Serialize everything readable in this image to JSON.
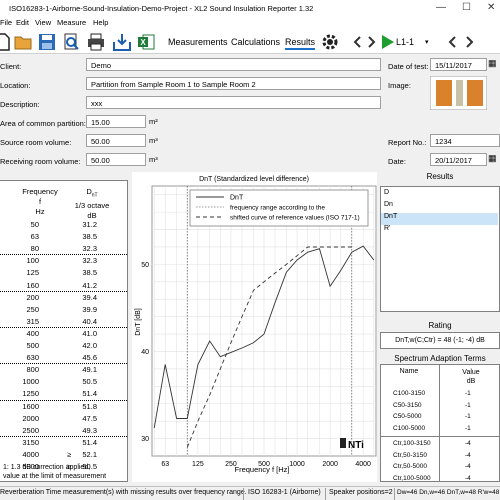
{
  "window": {
    "title": "ISO16283-1-Airborne-Sound-Insulation-Demo-Project - XL2 Sound Insulation Reporter 1.32"
  },
  "menu": {
    "file": "File",
    "edit": "Edit",
    "view": "View",
    "measure": "Measure",
    "help": "Help"
  },
  "toolbar": {
    "measurements": "Measurements",
    "calculations": "Calculations",
    "results": "Results",
    "position": "L1-1"
  },
  "form": {
    "client_label": "Client:",
    "client_value": "Demo",
    "location_label": "Location:",
    "location_value": "Partition from Sample Room 1 to Sample Room 2",
    "description_label": "Description:",
    "description_value": "xxx",
    "area_label": "Area of common partition:",
    "area_value": "15.00",
    "area_unit": "m²",
    "source_label": "Source room volume:",
    "source_value": "50.00",
    "source_unit": "m³",
    "receiving_label": "Receiving room volume:",
    "receiving_value": "50.00",
    "receiving_unit": "m³",
    "date_of_test_label": "Date of test:",
    "date_of_test_value": "15/11/2017",
    "image_label": "Image:",
    "report_label": "Report No.:",
    "report_value": "1234",
    "date_label": "Date:",
    "date_value": "20/11/2017"
  },
  "table": {
    "col1_header": [
      "Frequency",
      "f",
      "Hz"
    ],
    "col2_header": [
      "DnT",
      "1/3 octave",
      "dB"
    ],
    "rows": [
      {
        "f": "50",
        "q": "",
        "v": "31.2"
      },
      {
        "f": "63",
        "q": "",
        "v": "38.5"
      },
      {
        "f": "80",
        "q": "",
        "v": "32.3"
      },
      {
        "f": "100",
        "q": "",
        "v": "32.3"
      },
      {
        "f": "125",
        "q": "",
        "v": "38.5"
      },
      {
        "f": "160",
        "q": "",
        "v": "41.2"
      },
      {
        "f": "200",
        "q": "",
        "v": "39.4"
      },
      {
        "f": "250",
        "q": "",
        "v": "39.9"
      },
      {
        "f": "315",
        "q": "",
        "v": "40.4"
      },
      {
        "f": "400",
        "q": "",
        "v": "41.0"
      },
      {
        "f": "500",
        "q": "",
        "v": "42.0"
      },
      {
        "f": "630",
        "q": "",
        "v": "45.6"
      },
      {
        "f": "800",
        "q": "",
        "v": "49.1"
      },
      {
        "f": "1000",
        "q": "",
        "v": "50.5"
      },
      {
        "f": "1250",
        "q": "",
        "v": "51.4"
      },
      {
        "f": "1600",
        "q": "",
        "v": "51.8"
      },
      {
        "f": "2000",
        "q": "",
        "v": "47.5"
      },
      {
        "f": "2500",
        "q": "",
        "v": "49.3"
      },
      {
        "f": "3150",
        "q": "",
        "v": "51.4"
      },
      {
        "f": "4000",
        "q": "≥",
        "v": "52.1"
      },
      {
        "f": "5000",
        "q": "≥",
        "v": "50.5"
      }
    ],
    "note1": "1: 1.3 dB correction applied,",
    "note2": "value at the limit of measurement"
  },
  "chart_data": {
    "type": "line",
    "title": "DnT (Standardized level difference)",
    "xlabel": "Frequency f [Hz]",
    "ylabel": "DnT [dB]",
    "x": [
      50,
      63,
      80,
      100,
      125,
      160,
      200,
      250,
      315,
      400,
      500,
      630,
      800,
      1000,
      1250,
      1600,
      2000,
      2500,
      3150,
      4000,
      5000
    ],
    "xticks": [
      "63",
      "125",
      "250",
      "500",
      "1000",
      "2000",
      "4000"
    ],
    "yticks": [
      30,
      40,
      50
    ],
    "ylim": [
      28,
      59
    ],
    "series": [
      {
        "name": "DnT",
        "style": "solid",
        "values": [
          31.2,
          38.5,
          32.3,
          32.3,
          38.5,
          41.2,
          39.4,
          39.9,
          40.4,
          41.0,
          42.0,
          45.6,
          49.1,
          50.5,
          51.4,
          51.8,
          47.5,
          49.3,
          51.4,
          52.1,
          50.5
        ]
      },
      {
        "name": "",
        "style": "dashed",
        "x": [
          100,
          125,
          160,
          200,
          250,
          315,
          400,
          500,
          630,
          800,
          1000,
          1250,
          1600,
          2000,
          2500,
          3150
        ],
        "values": [
          29,
          32,
          35,
          38,
          41,
          44,
          47,
          48,
          49,
          50,
          51,
          52,
          52,
          52,
          52,
          52
        ]
      }
    ],
    "legend": [
      "DnT",
      "frequency range according to the",
      "shifted curve of reference values (ISO 717-1)"
    ],
    "legend_position": "top-right",
    "freq_range_lines": [
      100,
      3150
    ],
    "grid": true,
    "brand": "NTi"
  },
  "results": {
    "title": "Results",
    "items": [
      "D",
      "Dn",
      "DnT",
      "R'"
    ],
    "selected": 2,
    "rating_title": "Rating",
    "rating_value": "DnT,w(C;Ctr) = 48 (-1; -4) dB",
    "spectrum_title": "Spectrum Adaption Terms",
    "col_name": "Name",
    "col_value": [
      "Value",
      "dB"
    ],
    "terms": [
      {
        "n": "C100-3150",
        "v": "-1"
      },
      {
        "n": "C50-3150",
        "v": "-1"
      },
      {
        "n": "C50-5000",
        "v": "-1"
      },
      {
        "n": "C100-5000",
        "v": "-1"
      },
      {
        "n": "Ctr,100-3150",
        "v": "-4"
      },
      {
        "n": "Ctr,50-3150",
        "v": "-4"
      },
      {
        "n": "Ctr,50-5000",
        "v": "-4"
      },
      {
        "n": "Ctr,100-5000",
        "v": "-4"
      }
    ]
  },
  "status": {
    "warning": "Reverberation Time measurement(s) with missing results over frequency range.",
    "standard": "ISO 16283-1 (Airborne)",
    "positions": "Speaker positions=2",
    "values": "Dw=46  Dn,w=46  DnT,w=48  R'w=48"
  },
  "colors": {
    "accent": "#1e70c8",
    "selected": "#cce4f7",
    "play_green": "#1e9e2e",
    "excel_green": "#1f7a3a"
  }
}
